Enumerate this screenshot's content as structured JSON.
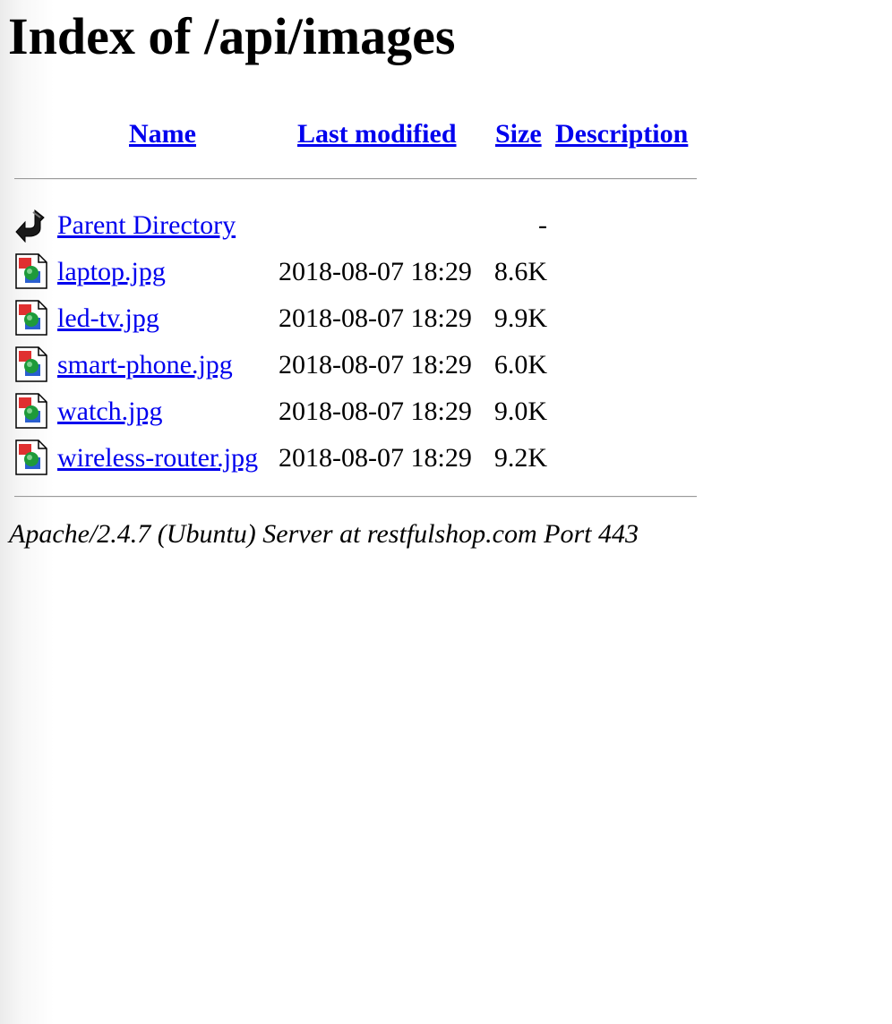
{
  "page": {
    "title": "Index of /api/images"
  },
  "columns": {
    "name": "Name",
    "last_modified": "Last modified",
    "size": "Size",
    "description": "Description"
  },
  "parent": {
    "label": "Parent Directory",
    "size": "-",
    "icon": "back-arrow-icon"
  },
  "files": [
    {
      "name": "laptop.jpg",
      "modified": "2018-08-07 18:29",
      "size": "8.6K",
      "icon": "image-file-icon"
    },
    {
      "name": "led-tv.jpg",
      "modified": "2018-08-07 18:29",
      "size": "9.9K",
      "icon": "image-file-icon"
    },
    {
      "name": "smart-phone.jpg",
      "modified": "2018-08-07 18:29",
      "size": "6.0K",
      "icon": "image-file-icon"
    },
    {
      "name": "watch.jpg",
      "modified": "2018-08-07 18:29",
      "size": "9.0K",
      "icon": "image-file-icon"
    },
    {
      "name": "wireless-router.jpg",
      "modified": "2018-08-07 18:29",
      "size": "9.2K",
      "icon": "image-file-icon"
    }
  ],
  "footer": {
    "server": "Apache/2.4.7 (Ubuntu) Server at restfulshop.com Port 443"
  },
  "colors": {
    "link": "#0000ee",
    "text": "#000000",
    "rule": "#9a9a9a"
  }
}
